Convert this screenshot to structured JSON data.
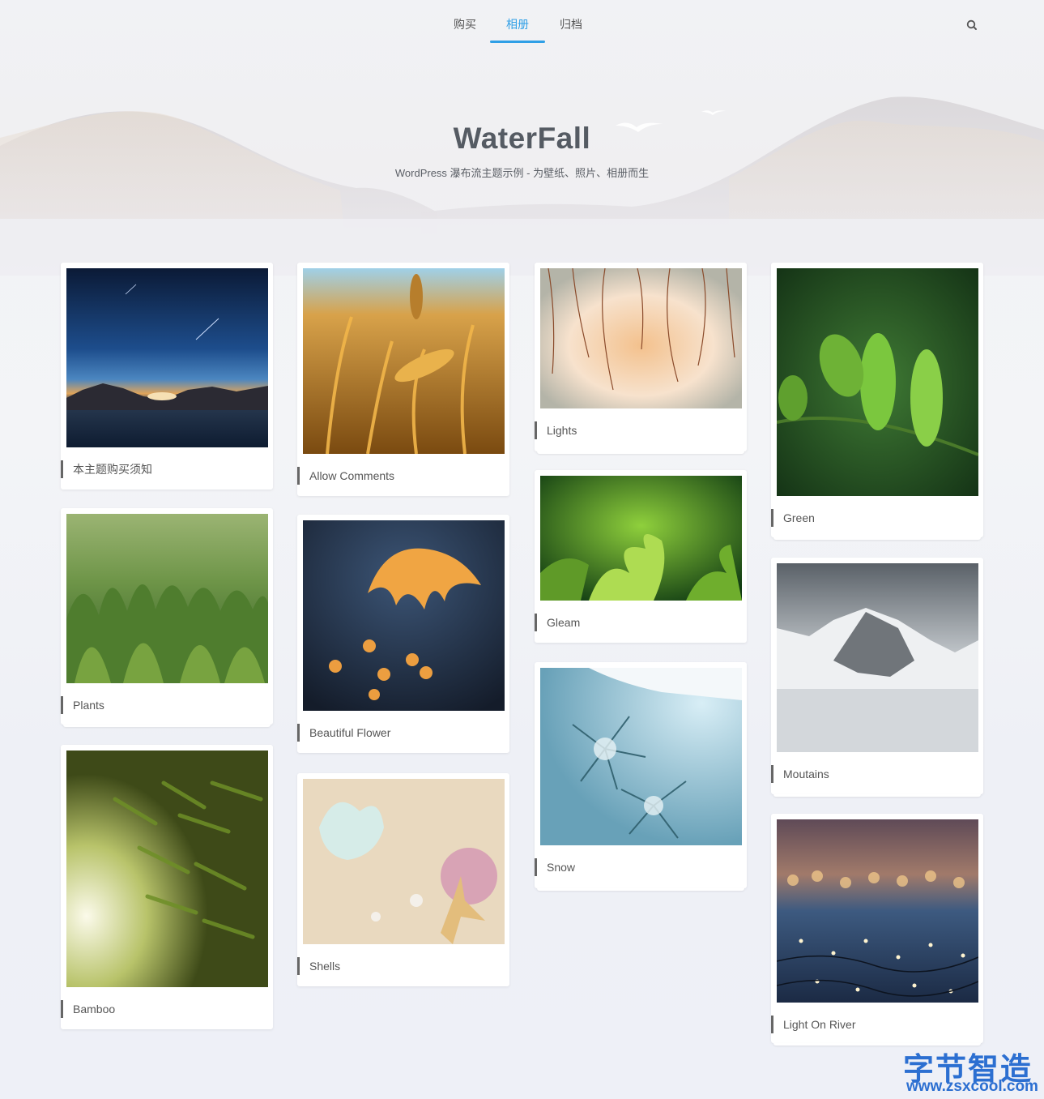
{
  "nav": {
    "items": [
      {
        "label": "购买"
      },
      {
        "label": "相册"
      },
      {
        "label": "归档"
      }
    ],
    "active_index": 1,
    "search_icon": "search-icon"
  },
  "hero": {
    "title": "WaterFall",
    "subtitle": "WordPress 瀑布流主题示例 - 为壁纸、照片、相册而生"
  },
  "cards": [
    {
      "label": "本主题购买须知",
      "image": "night-sky-meteor-lake"
    },
    {
      "label": "Plants",
      "image": "green-grass-closeup"
    },
    {
      "label": "Bamboo",
      "image": "bamboo-leaves-sunlight"
    },
    {
      "label": "Allow Comments",
      "image": "golden-wheat"
    },
    {
      "label": "Beautiful Flower",
      "image": "orange-flower-bokeh"
    },
    {
      "label": "Shells",
      "image": "seashells-on-sand"
    },
    {
      "label": "Lights",
      "image": "willow-branches-warm-light"
    },
    {
      "label": "Gleam",
      "image": "green-sprouts"
    },
    {
      "label": "Snow",
      "image": "snowy-pine-branch"
    },
    {
      "label": "Green",
      "image": "green-leaves-dark-bg"
    },
    {
      "label": "Moutains",
      "image": "snowy-mountains"
    },
    {
      "label": "Light On River",
      "image": "bokeh-lights-river"
    }
  ],
  "watermark": {
    "text": "字节智造",
    "url": "www.zsxcool.com"
  },
  "colors": {
    "accent": "#2f9fe6",
    "label_bar": "#666666"
  }
}
